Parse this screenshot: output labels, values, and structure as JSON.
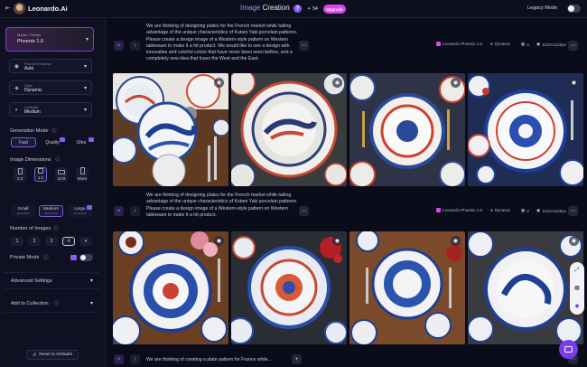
{
  "header": {
    "brand": "Leonardo.Ai",
    "title_part1": "Image",
    "title_part2": "Creation",
    "tokens": "54",
    "upgrade_label": "Upgrade",
    "legacy_mode_label": "Legacy Mode",
    "accent": "#8b5cf6"
  },
  "sidebar": {
    "model_label": "Model / Preset",
    "model_value": "Phoenix 1.0",
    "prompt_enhance_label": "Prompt Enhance",
    "prompt_enhance_value": "Auto",
    "style_label": "Style",
    "style_value": "Dynamic",
    "contrast_label": "Contrast",
    "contrast_value": "Medium",
    "generation_mode_label": "Generation Mode",
    "generation_modes": [
      "Fast",
      "Quality",
      "Ultra"
    ],
    "generation_mode_selected": "Fast",
    "image_dimensions_label": "Image Dimensions",
    "aspect_ratios": [
      "2:3",
      "1:1",
      "16:9",
      "More"
    ],
    "aspect_selected": "1:1",
    "sizes": [
      {
        "label": "Small",
        "sub": "1024x1024"
      },
      {
        "label": "Medium",
        "sub": "1120x1120"
      },
      {
        "label": "Large",
        "sub": "1472x1472"
      }
    ],
    "size_selected": "Medium",
    "num_images_label": "Number of Images",
    "num_images": [
      "1",
      "2",
      "3",
      "4"
    ],
    "num_images_selected": "4",
    "private_mode_label": "Private Mode",
    "advanced_settings_label": "Advanced Settings",
    "add_to_collection_label": "Add to Collection",
    "reset_label": "Reset to Defaults"
  },
  "generations": [
    {
      "prompt": "We are thinking of designing plates for the French market while taking advantage of the unique characteristics of Kutani Yaki porcelain patterns. Please create a design image of a Western-style pattern on Western tableware to make it a hit product. We would like to see a design with innovative and colorful colors that have never been seen before, and a completely new idea that fuses the West and the East.",
      "model": "Leonardo Phoenix 1.0",
      "style": "Dynamic",
      "count": "4",
      "size": "1120×1120px"
    },
    {
      "prompt": "We are thinking of designing plates for the French market while taking advantage of the unique characteristics of Kutani Yaki porcelain patterns. Please create a design image of a Western-style pattern on Western tableware to make it a hit product.",
      "model": "Leonardo Phoenix 1.0",
      "style": "Dynamic",
      "count": "4",
      "size": "1120×1120px"
    },
    {
      "prompt": "We are thinking of creating a plate pattern for France while..."
    }
  ]
}
